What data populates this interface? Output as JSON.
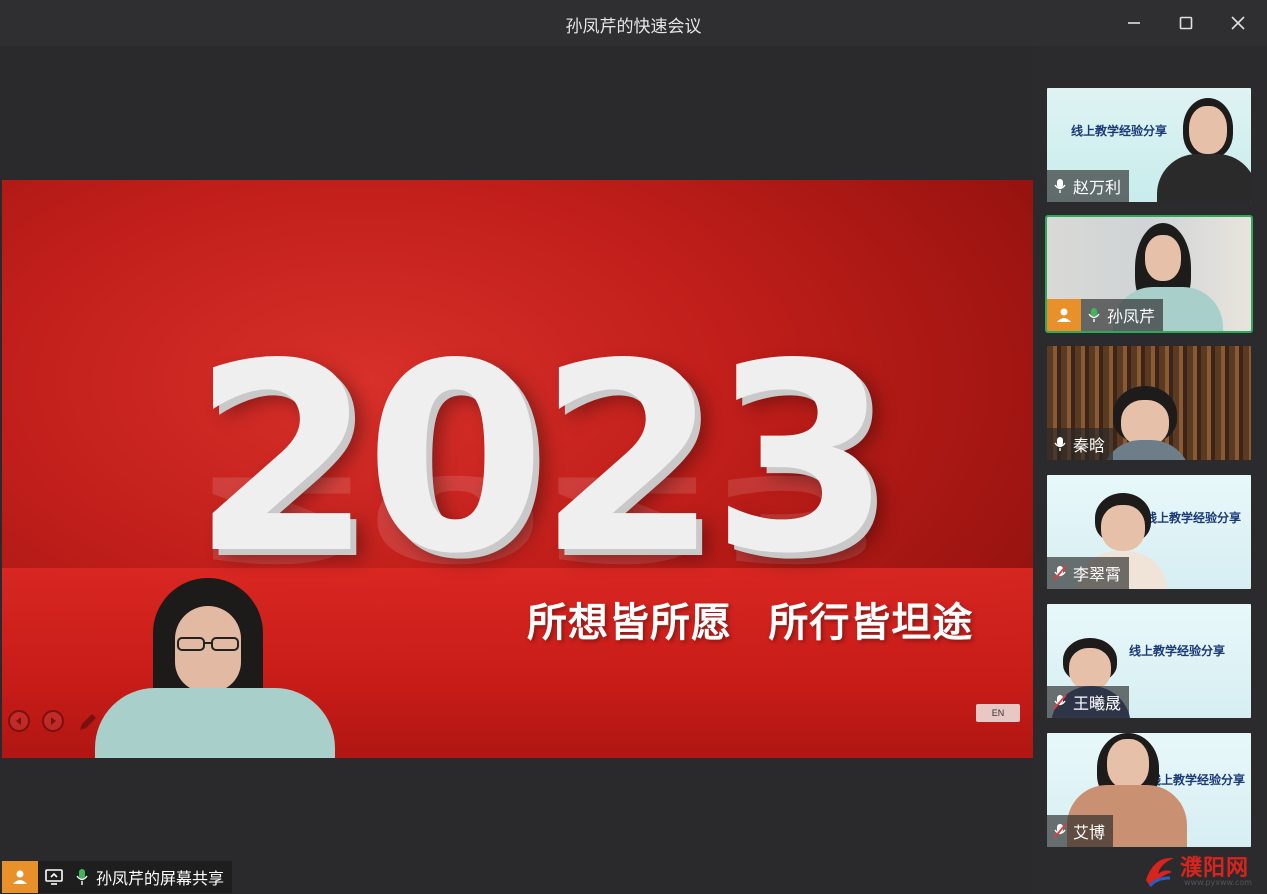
{
  "window": {
    "title": "孙凤芹的快速会议",
    "minimize_icon": "minimize-icon",
    "maximize_icon": "maximize-icon",
    "close_icon": "close-icon"
  },
  "slide": {
    "year": "2023",
    "slogan": "所想皆所愿   所行皆坦途",
    "lang_badge": "EN",
    "controls": [
      "prev-slide-icon",
      "next-slide-icon",
      "pen-icon"
    ],
    "background_color": "#c01e1a"
  },
  "share": {
    "label": "孙凤芹的屏幕共享",
    "host_color": "#e8912a"
  },
  "participants": [
    {
      "name": "赵万利",
      "doc_title": "线上教学经验分享",
      "mic": "on",
      "active": false
    },
    {
      "name": "孙凤芹",
      "doc_title": "",
      "mic": "on",
      "active": true,
      "host": true
    },
    {
      "name": "秦晗",
      "doc_title": "",
      "mic": "on",
      "active": false
    },
    {
      "name": "李翠霄",
      "doc_title": "线上教学经验分享",
      "mic": "muted",
      "active": false
    },
    {
      "name": "王曦晟",
      "doc_title": "线上教学经验分享",
      "mic": "muted",
      "active": false
    },
    {
      "name": "艾博",
      "doc_title": "线上教学经验分享",
      "mic": "muted",
      "active": false
    }
  ],
  "watermark": {
    "text": "濮阳网",
    "url": "www.pyxww.com"
  }
}
